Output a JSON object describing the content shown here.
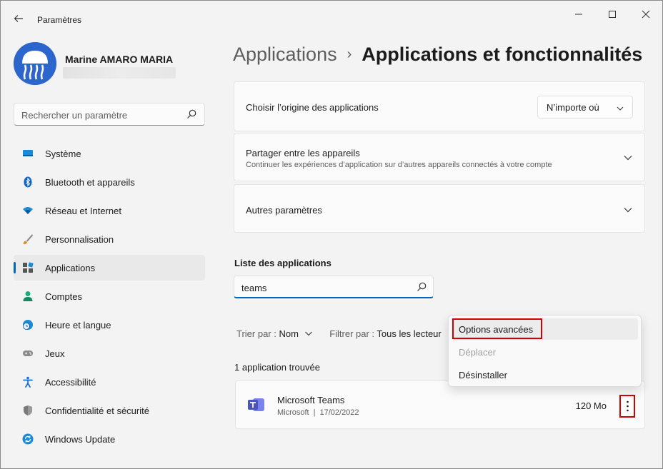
{
  "window": {
    "title": "Paramètres"
  },
  "profile": {
    "name": "Marine AMARO MARIA"
  },
  "search": {
    "placeholder": "Rechercher un paramètre"
  },
  "sidebar": {
    "items": [
      {
        "label": "Système",
        "icon": "system-icon"
      },
      {
        "label": "Bluetooth et appareils",
        "icon": "bluetooth-icon"
      },
      {
        "label": "Réseau et Internet",
        "icon": "wifi-icon"
      },
      {
        "label": "Personnalisation",
        "icon": "brush-icon"
      },
      {
        "label": "Applications",
        "icon": "apps-icon",
        "active": true
      },
      {
        "label": "Comptes",
        "icon": "person-icon"
      },
      {
        "label": "Heure et langue",
        "icon": "clock-globe-icon"
      },
      {
        "label": "Jeux",
        "icon": "gamepad-icon"
      },
      {
        "label": "Accessibilité",
        "icon": "accessibility-icon"
      },
      {
        "label": "Confidentialité et sécurité",
        "icon": "shield-icon"
      },
      {
        "label": "Windows Update",
        "icon": "update-icon"
      }
    ]
  },
  "breadcrumb": {
    "parent": "Applications",
    "separator": "›",
    "current": "Applications et fonctionnalités"
  },
  "cards": {
    "origin": {
      "title": "Choisir l’origine des applications",
      "dropdown_value": "N’importe où"
    },
    "share": {
      "title": "Partager entre les appareils",
      "subtitle": "Continuer les expériences d’application sur d’autres appareils connectés à votre compte"
    },
    "other": {
      "title": "Autres paramètres"
    }
  },
  "app_list": {
    "title": "Liste des applications",
    "search_value": "teams",
    "sort_label": "Trier par :",
    "sort_value": "Nom",
    "filter_label": "Filtrer par :",
    "filter_value": "Tous les lecteur",
    "count_text": "1 application trouvée",
    "apps": [
      {
        "name": "Microsoft Teams",
        "publisher": "Microsoft",
        "separator": "|",
        "date": "17/02/2022",
        "size": "120 Mo"
      }
    ]
  },
  "context_menu": {
    "items": [
      {
        "label": "Options avancées",
        "enabled": true
      },
      {
        "label": "Déplacer",
        "enabled": false
      },
      {
        "label": "Désinstaller",
        "enabled": true
      }
    ]
  },
  "colors": {
    "accent": "#0067c0",
    "highlight_red": "#d40000",
    "background": "#f3f3f3",
    "card": "#fbfbfb"
  }
}
